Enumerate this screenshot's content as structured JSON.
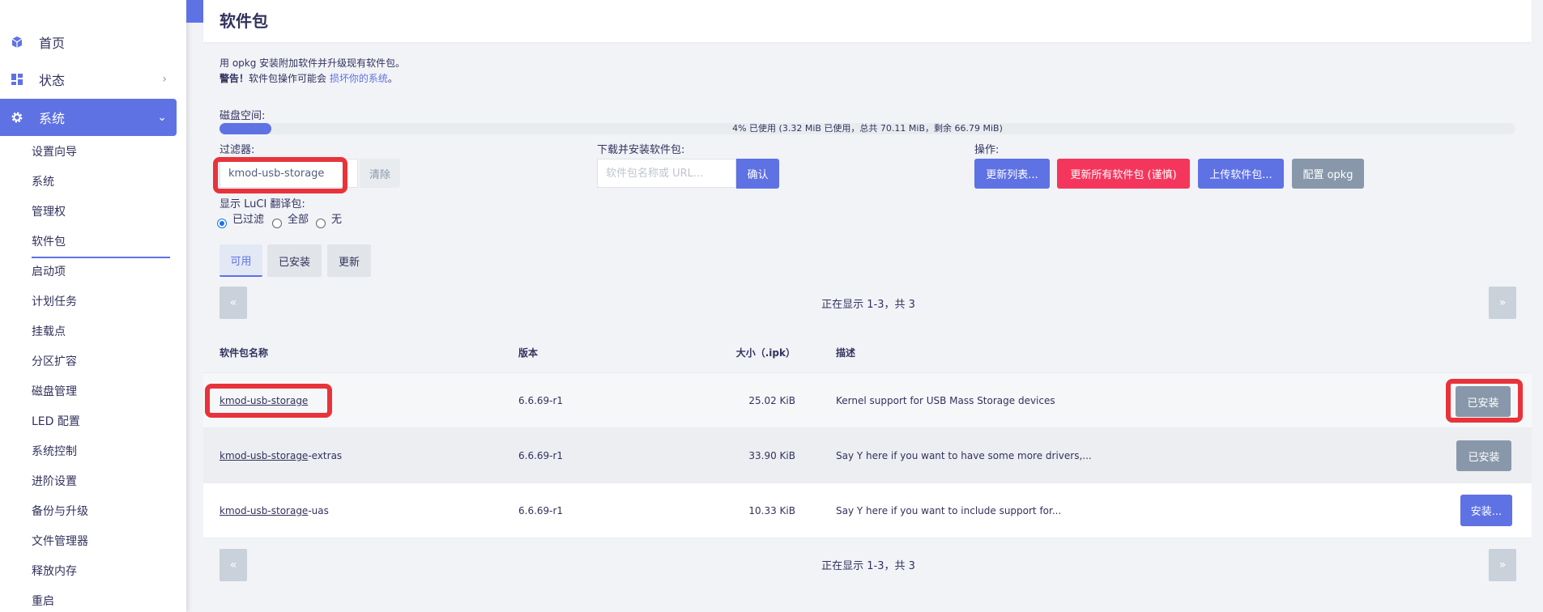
{
  "sidebar": {
    "top": [
      {
        "label": "首页",
        "icon": "cube-icon"
      },
      {
        "label": "状态",
        "icon": "dashboard-icon"
      },
      {
        "label": "系统",
        "icon": "gear-icon"
      }
    ],
    "sub": [
      "设置向导",
      "系统",
      "管理权",
      "软件包",
      "启动项",
      "计划任务",
      "挂载点",
      "分区扩容",
      "磁盘管理",
      "LED 配置",
      "系统控制",
      "进阶设置",
      "备份与升级",
      "文件管理器",
      "释放内存",
      "重启"
    ]
  },
  "page": {
    "title": "软件包",
    "intro": "用 opkg 安装附加软件并升级现有软件包。",
    "warning_bold": "警告！",
    "warning_text": "软件包操作可能会",
    "warning_link": "损坏你的系统",
    "warning_end": "。"
  },
  "disk": {
    "label": "磁盘空间:",
    "used_percent": 4,
    "text": "4% 已使用 (3.32 MiB 已使用，总共 70.11 MiB，剩余 66.79 MiB)"
  },
  "filter": {
    "label": "过滤器:",
    "value": "kmod-usb-storage",
    "clear_label": "清除"
  },
  "download": {
    "label": "下载并安装软件包:",
    "placeholder": "软件包名称或 URL...",
    "confirm_label": "确认"
  },
  "actions": {
    "label": "操作:",
    "update_lists": "更新列表...",
    "upgrade_all": "更新所有软件包 (谨慎)",
    "upload": "上传软件包...",
    "configure": "配置 opkg"
  },
  "translations": {
    "label": "显示 LuCI 翻译包:",
    "options": [
      "已过滤",
      "全部",
      "无"
    ],
    "selected": "已过滤"
  },
  "tabs": [
    "可用",
    "已安装",
    "更新"
  ],
  "pager": {
    "prev": "«",
    "next": "»",
    "text": "正在显示 1-3，共 3"
  },
  "table": {
    "headers": [
      "软件包名称",
      "版本",
      "大小（.ipk）",
      "描述"
    ],
    "rows": [
      {
        "name": "kmod-usb-storage",
        "suffix": "",
        "version": "6.6.69-r1",
        "size": "25.02 KiB",
        "desc": "Kernel support for USB Mass Storage devices",
        "action": "已安装"
      },
      {
        "name": "kmod-usb-storage",
        "suffix": "-extras",
        "version": "6.6.69-r1",
        "size": "33.90 KiB",
        "desc": "Say Y here if you want to have some more drivers,...",
        "action": "已安装"
      },
      {
        "name": "kmod-usb-storage",
        "suffix": "-uas",
        "version": "6.6.69-r1",
        "size": "10.33 KiB",
        "desc": "Say Y here if you want to include support for...",
        "action": "安装..."
      }
    ]
  },
  "colors": {
    "accent": "#5e72e4",
    "danger": "#f5365c",
    "muted": "#8898aa",
    "highlight": "#e8333a"
  }
}
